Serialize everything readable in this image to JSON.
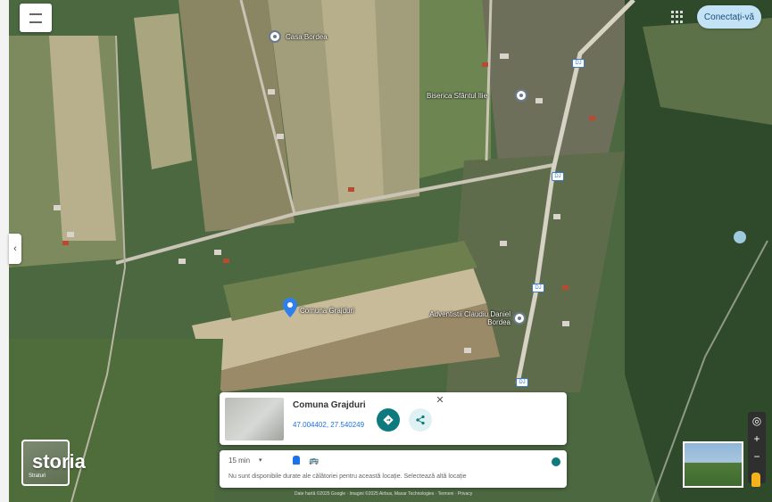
{
  "header": {
    "menu_icon": "menu-icon",
    "signin_label": "Conectați-vă",
    "apps_icon": "apps-grid-icon"
  },
  "map": {
    "place_labels": [
      {
        "text": "Casa Bordea"
      },
      {
        "text": "Biserica Sfântul Ilie"
      },
      {
        "text": "Comuna Grajduri"
      },
      {
        "text": "Adventistii Claudiu Daniel Bordea"
      }
    ],
    "road_badges": [
      "DJ",
      "DJ",
      "DJ",
      "DJ",
      "DJ"
    ]
  },
  "place_card": {
    "title": "Comuna Grajduri",
    "coordinates": "47.004402, 27.540249",
    "directions_icon": "directions-icon",
    "share_icon": "share-icon",
    "close_icon": "close-icon"
  },
  "travel_panel": {
    "mode_label": "15 min",
    "note": "Nu sunt disponibile durate ale călătoriei pentru această locație. Selectează altă locație"
  },
  "layers": {
    "label": "Straturi"
  },
  "watermark": "storia",
  "footer": "Date hartă ©2025 Google · Imagini ©2025 Airbus, Maxar Technologies · Termeni · Privacy",
  "colors": {
    "accent": "#0f7a7e",
    "signin_bg": "#c4e2f6",
    "link": "#1a73e8"
  }
}
